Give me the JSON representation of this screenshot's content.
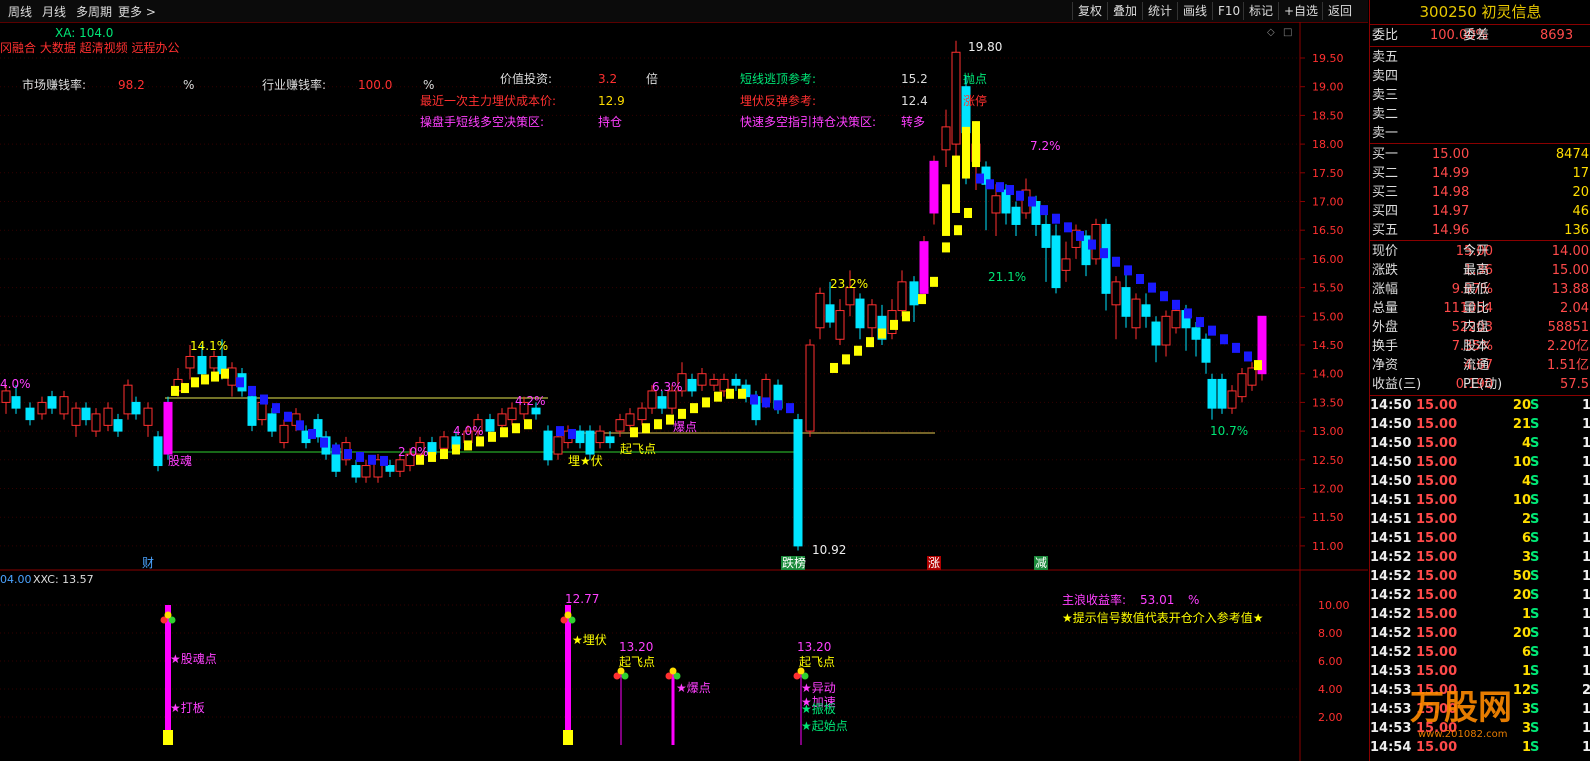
{
  "toolbar": {
    "left": [
      "周线",
      "月线",
      "多周期",
      "更多 >"
    ],
    "right": [
      "复权",
      "叠加",
      "统计",
      "画线",
      "F10",
      "标记",
      "+自选",
      "返回"
    ]
  },
  "main": {
    "indicator_line": "XA: 104.0",
    "banner": "冈融合 大数据 超清视频 远程办公",
    "stats": {
      "market_rate_label": "市场赚钱率:",
      "market_rate_value": "98.2",
      "market_rate_unit": "%",
      "industry_rate_label": "行业赚钱率:",
      "industry_rate_value": "100.0",
      "industry_rate_unit": "%",
      "value_invest_label": "价值投资:",
      "value_invest_value": "3.2",
      "value_invest_unit": "倍",
      "last_cost_label": "最近一次主力埋伏成本价:",
      "last_cost_value": "12.9",
      "trader_label": "操盘手短线多空决策区:",
      "trader_value": "持仓",
      "top_ref_label": "短线逃顶参考:",
      "top_ref_value": "15.2",
      "top_ref_tag": "抛点",
      "rebound_label": "埋伏反弹参考:",
      "rebound_value": "12.4",
      "rebound_tag": "涨停",
      "quick_label": "快速多空指引持仓决策区:",
      "quick_value": "转多"
    },
    "y_axis": [
      "19.50",
      "19.00",
      "18.50",
      "18.00",
      "17.50",
      "17.00",
      "16.50",
      "16.00",
      "15.50",
      "15.00",
      "14.50",
      "14.00",
      "13.50",
      "13.00",
      "12.50",
      "12.00",
      "11.50",
      "11.00"
    ],
    "annotations": {
      "high": "19.80",
      "low": "10.92",
      "pct_23": "23.2%",
      "pct_21": "21.1%",
      "pct_72": "7.2%",
      "pct_141": "14.1%",
      "pct_40a": "4.0%",
      "pct_40b": "4.0%",
      "pct_42": "4.2%",
      "pct_20": "2.0%",
      "pct_63": "6.3%",
      "pct_107": "10.7%",
      "gu_hun": "股魂",
      "mai_fu": "埋★伏",
      "qi_fei": "起飞点",
      "bao_dian": "爆点"
    },
    "bottom_tags": [
      "财",
      "跌榜",
      "涨",
      "减"
    ]
  },
  "sub": {
    "header_left": "04.00",
    "header_xxc": "XXC: 13.57",
    "return_label": "主浪收益率:",
    "return_value": "53.01",
    "return_unit": "%",
    "hint": "★提示信号数值代表开仓介入参考值★",
    "y_axis": [
      "10.00",
      "8.00",
      "6.00",
      "4.00",
      "2.00"
    ],
    "signals": {
      "v1": "12.77",
      "v2": "13.20",
      "v3": "13.20",
      "s_guhun": "★股魂点",
      "s_daban": "★打板",
      "s_maifu": "★埋伏",
      "s_qifei1": "起飞点",
      "s_baodian": "★爆点",
      "s_qifei2": "起飞点",
      "s_yidong": "★异动",
      "s_jiasu": "★加速",
      "s_zhenban": "★振板",
      "s_qishi": "★起始点"
    }
  },
  "quote": {
    "title": "300250 初灵信息",
    "weibi_label": "委比",
    "weibi_value": "100.00%",
    "weicha_label": "委差",
    "weicha_value": "8693",
    "asks": [
      {
        "label": "卖五",
        "price": "",
        "vol": ""
      },
      {
        "label": "卖四",
        "price": "",
        "vol": ""
      },
      {
        "label": "卖三",
        "price": "",
        "vol": ""
      },
      {
        "label": "卖二",
        "price": "",
        "vol": ""
      },
      {
        "label": "卖一",
        "price": "",
        "vol": ""
      }
    ],
    "bids": [
      {
        "label": "买一",
        "price": "15.00",
        "vol": "8474"
      },
      {
        "label": "买二",
        "price": "14.99",
        "vol": "17"
      },
      {
        "label": "买三",
        "price": "14.98",
        "vol": "20"
      },
      {
        "label": "买四",
        "price": "14.97",
        "vol": "46"
      },
      {
        "label": "买五",
        "price": "14.96",
        "vol": "136"
      }
    ],
    "stats": [
      {
        "l1": "现价",
        "v1": "15.00",
        "l2": "今开",
        "v2": "14.00"
      },
      {
        "l1": "涨跌",
        "v1": "1.36",
        "l2": "最高",
        "v2": "15.00"
      },
      {
        "l1": "涨幅",
        "v1": "9.97%",
        "l2": "最低",
        "v2": "13.88"
      },
      {
        "l1": "总量",
        "v1": "111054",
        "l2": "量比",
        "v2": "2.04"
      },
      {
        "l1": "外盘",
        "v1": "52203",
        "l2": "内盘",
        "v2": "58851"
      },
      {
        "l1": "换手",
        "v1": "7.35%",
        "l2": "股本",
        "v2": "2.20亿"
      },
      {
        "l1": "净资",
        "v1": "4.67",
        "l2": "流通",
        "v2": "1.51亿"
      },
      {
        "l1": "收益(三)",
        "v1": "0.190",
        "l2": "PE(动)",
        "v2": "57.5"
      }
    ],
    "ticks": [
      {
        "t": "14:50",
        "p": "15.00",
        "v": "20",
        "s": "S",
        "n": "1"
      },
      {
        "t": "14:50",
        "p": "15.00",
        "v": "21",
        "s": "S",
        "n": "1"
      },
      {
        "t": "14:50",
        "p": "15.00",
        "v": "4",
        "s": "S",
        "n": "1"
      },
      {
        "t": "14:50",
        "p": "15.00",
        "v": "10",
        "s": "S",
        "n": "1"
      },
      {
        "t": "14:50",
        "p": "15.00",
        "v": "4",
        "s": "S",
        "n": "1"
      },
      {
        "t": "14:51",
        "p": "15.00",
        "v": "10",
        "s": "S",
        "n": "1"
      },
      {
        "t": "14:51",
        "p": "15.00",
        "v": "2",
        "s": "S",
        "n": "1"
      },
      {
        "t": "14:51",
        "p": "15.00",
        "v": "6",
        "s": "S",
        "n": "1"
      },
      {
        "t": "14:52",
        "p": "15.00",
        "v": "3",
        "s": "S",
        "n": "1"
      },
      {
        "t": "14:52",
        "p": "15.00",
        "v": "50",
        "s": "S",
        "n": "1"
      },
      {
        "t": "14:52",
        "p": "15.00",
        "v": "20",
        "s": "S",
        "n": "1"
      },
      {
        "t": "14:52",
        "p": "15.00",
        "v": "1",
        "s": "S",
        "n": "1"
      },
      {
        "t": "14:52",
        "p": "15.00",
        "v": "20",
        "s": "S",
        "n": "1"
      },
      {
        "t": "14:52",
        "p": "15.00",
        "v": "6",
        "s": "S",
        "n": "1"
      },
      {
        "t": "14:53",
        "p": "15.00",
        "v": "1",
        "s": "S",
        "n": "1"
      },
      {
        "t": "14:53",
        "p": "15.00",
        "v": "12",
        "s": "S",
        "n": "2"
      },
      {
        "t": "14:53",
        "p": "15.00",
        "v": "3",
        "s": "S",
        "n": "1"
      },
      {
        "t": "14:53",
        "p": "15.00",
        "v": "3",
        "s": "S",
        "n": "1"
      },
      {
        "t": "14:54",
        "p": "15.00",
        "v": "1",
        "s": "S",
        "n": "1"
      }
    ],
    "watermark": "万股网",
    "watermark_url": "www.201082.com"
  },
  "colors": {
    "up": "#ff3030",
    "down": "#00e5ff",
    "yellow": "#ffff00",
    "blue": "#1a1aff",
    "magenta": "#ff00ff"
  }
}
